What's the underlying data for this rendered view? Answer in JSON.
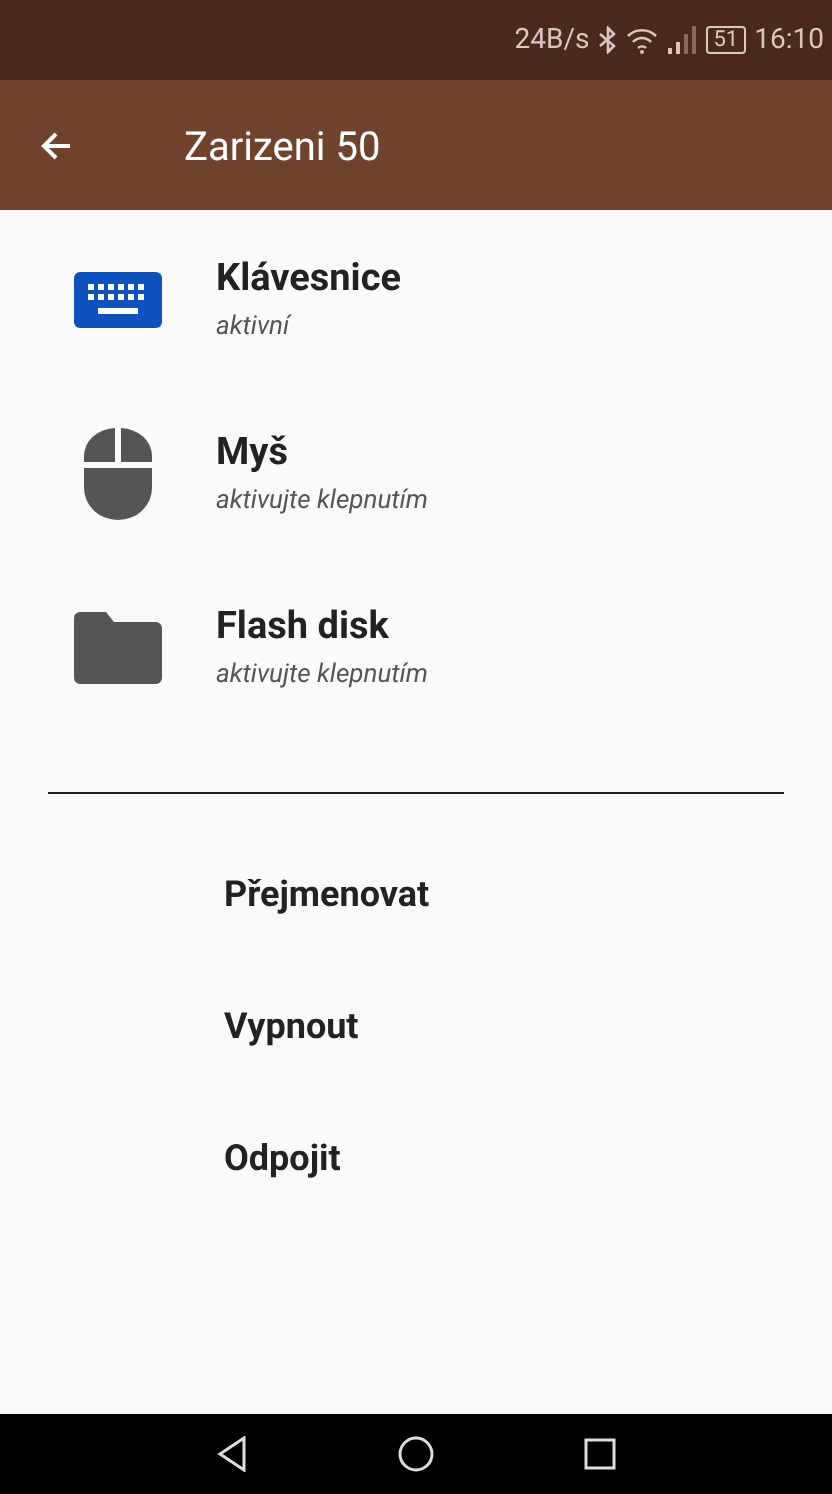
{
  "status_bar": {
    "net_speed": "24B/s",
    "battery": "51",
    "time": "16:10"
  },
  "app_bar": {
    "title": "Zarizeni 50"
  },
  "devices": [
    {
      "kind": "keyboard",
      "name": "Klávesnice",
      "status": "aktivní",
      "active": true
    },
    {
      "kind": "mouse",
      "name": "Myš",
      "status": "aktivujte klepnutím",
      "active": false
    },
    {
      "kind": "drive",
      "name": "Flash disk",
      "status": "aktivujte klepnutím",
      "active": false
    }
  ],
  "actions": [
    "Přejmenovat",
    "Vypnout",
    "Odpojit"
  ]
}
